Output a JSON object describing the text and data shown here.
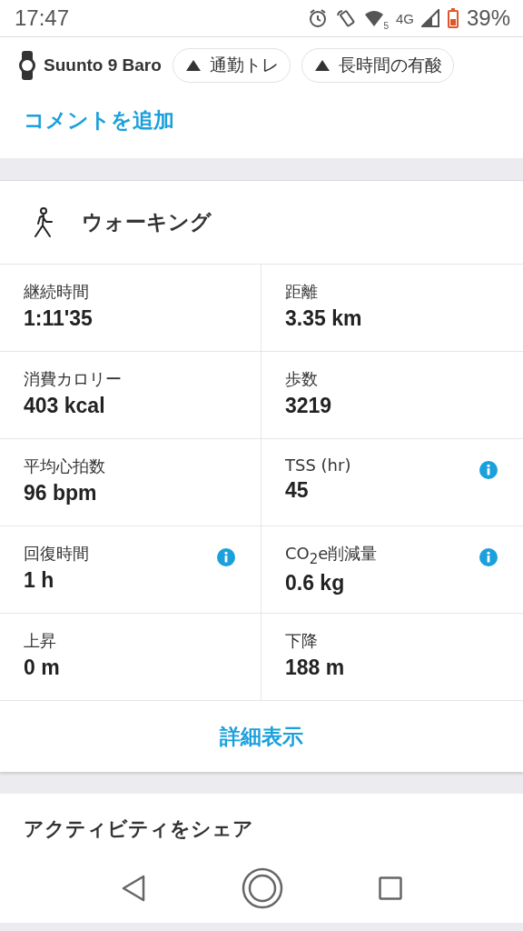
{
  "status_bar": {
    "time": "17:47",
    "network": "4G",
    "wifi_band": "5",
    "battery": "39%"
  },
  "device": {
    "name": "Suunto 9 Baro"
  },
  "tags": [
    {
      "label": "通勤トレ"
    },
    {
      "label": "長時間の有酸"
    }
  ],
  "comment_link": "コメントを追加",
  "activity": {
    "title": "ウォーキング"
  },
  "stats": [
    {
      "label": "継続時間",
      "value": "1:11'35",
      "info": false
    },
    {
      "label": "距離",
      "value": "3.35 km",
      "info": false
    },
    {
      "label": "消費カロリー",
      "value": "403 kcal",
      "info": false
    },
    {
      "label": "歩数",
      "value": "3219",
      "info": false
    },
    {
      "label": "平均心拍数",
      "value": "96 bpm",
      "info": false
    },
    {
      "label": "TSS (hr)",
      "value": "45",
      "info": true
    },
    {
      "label": "回復時間",
      "value": "1 h",
      "info": true
    },
    {
      "label": "CO$_{2}$e削減量",
      "value": "0.6 kg",
      "info": true
    },
    {
      "label": "上昇",
      "value": "0 m",
      "info": false
    },
    {
      "label": "下降",
      "value": "188 m",
      "info": false
    }
  ],
  "details_button": "詳細表示",
  "share_title": "アクティビティをシェア"
}
